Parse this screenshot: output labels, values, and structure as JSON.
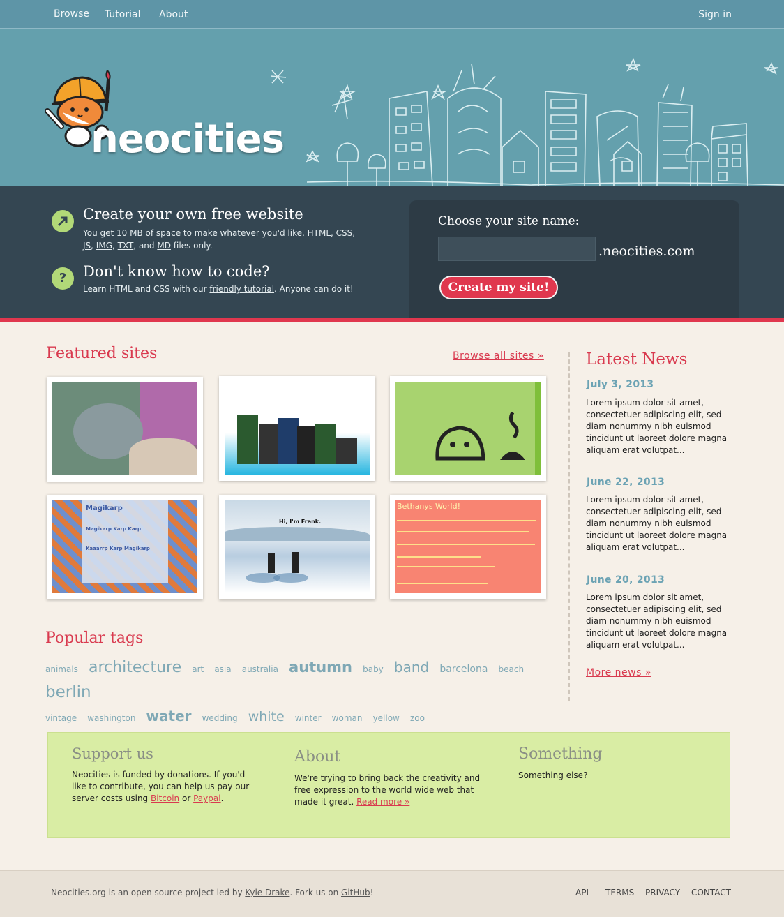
{
  "nav": {
    "browse": "Browse",
    "tutorial": "Tutorial",
    "about": "About",
    "signin": "Sign in"
  },
  "brand": {
    "name": "neocities"
  },
  "cta": {
    "item1_title": "Create your own free website",
    "item1_text_a": "You get 10 MB of space to make whatever you'd like.",
    "item1_html": "HTML",
    "item1_css": "CSS",
    "item1_js": "JS",
    "item1_img": "IMG",
    "item1_txt": "TXT",
    "item1_and": "and",
    "item1_md": "MD",
    "item1_text_b": "files only.",
    "item2_title": "Don't know how to code?",
    "item2_text_a": "Learn HTML and CSS with our",
    "item2_link": "friendly tutorial",
    "item2_text_b": ". Anyone can do it!",
    "icon1": "arrow-up-right-icon",
    "icon2": "question-mark-icon",
    "icon2_glyph": "?"
  },
  "signup": {
    "label": "Choose your site name:",
    "input_value": "",
    "domain": ".neocities.com",
    "button": "Create my site!"
  },
  "featured": {
    "title": "Featured sites",
    "browse_all": "Browse all sites »",
    "sites": [
      {
        "name": "cat-photo-site"
      },
      {
        "name": "xkcd-table-titans-site"
      },
      {
        "name": "green-pixel-chick-site"
      },
      {
        "name": "magikarp-site",
        "heading": "Magikarp",
        "sub1": "Magikarp Karp Karp",
        "sub2": "Kaaarrp Karp Magikarp"
      },
      {
        "name": "snow-figures-site",
        "heading": "Hi, I'm Frank."
      },
      {
        "name": "bethanys-world-site",
        "heading": "Bethanys World!"
      }
    ]
  },
  "tags": {
    "title": "Popular tags",
    "items": [
      "animals",
      "architecture",
      "art",
      "asia",
      "australia",
      "autumn",
      "baby",
      "band",
      "barcelona",
      "beach",
      "berlin",
      "vintage",
      "washington",
      "water",
      "wedding",
      "white",
      "winter",
      "woman",
      "yellow",
      "zoo"
    ]
  },
  "news": {
    "title": "Latest News",
    "items": [
      {
        "date": "July 3, 2013",
        "body": "Lorem ipsum dolor sit amet, consectetuer adipiscing elit, sed diam nonummy nibh euismod tincidunt ut laoreet dolore magna aliquam erat volutpat..."
      },
      {
        "date": "June 22, 2013",
        "body": "Lorem ipsum dolor sit amet, consectetuer adipiscing elit, sed diam nonummy nibh euismod tincidunt ut laoreet dolore magna aliquam erat volutpat..."
      },
      {
        "date": "June 20, 2013",
        "body": "Lorem ipsum dolor sit amet, consectetuer adipiscing elit, sed diam nonummy nibh euismod tincidunt ut laoreet dolore magna aliquam erat volutpat..."
      }
    ],
    "more": "More news »"
  },
  "info": {
    "support_title": "Support us",
    "support_text_a": "Neocities is funded by donations. If you'd like to contribute, you can help us pay our server costs using",
    "support_bitcoin": "Bitcoin",
    "support_or": "or",
    "support_paypal": "Paypal",
    "support_end": ".",
    "about_title": "About",
    "about_text": "We're trying to bring back the creativity and free expression to the world wide web that made it great.",
    "about_link": "Read more »",
    "something_title": "Something",
    "something_text": "Something else?"
  },
  "footer": {
    "text_a": "Neocities.org is an open source project led by",
    "author": "Kyle Drake",
    "text_b": ". Fork us on",
    "github": "GitHub",
    "text_c": "!",
    "api": "API",
    "terms": "TERMS",
    "privacy": "PRIVACY",
    "contact": "CONTACT"
  },
  "colors": {
    "nav_bg": "#5e95a7",
    "hero_bg": "#64a0ad",
    "cta_bg": "#344652",
    "accent_red": "#e0374e",
    "page_bg": "#f6f0e8",
    "info_green": "#d9eda4",
    "link_blue": "#6ca3b4"
  }
}
